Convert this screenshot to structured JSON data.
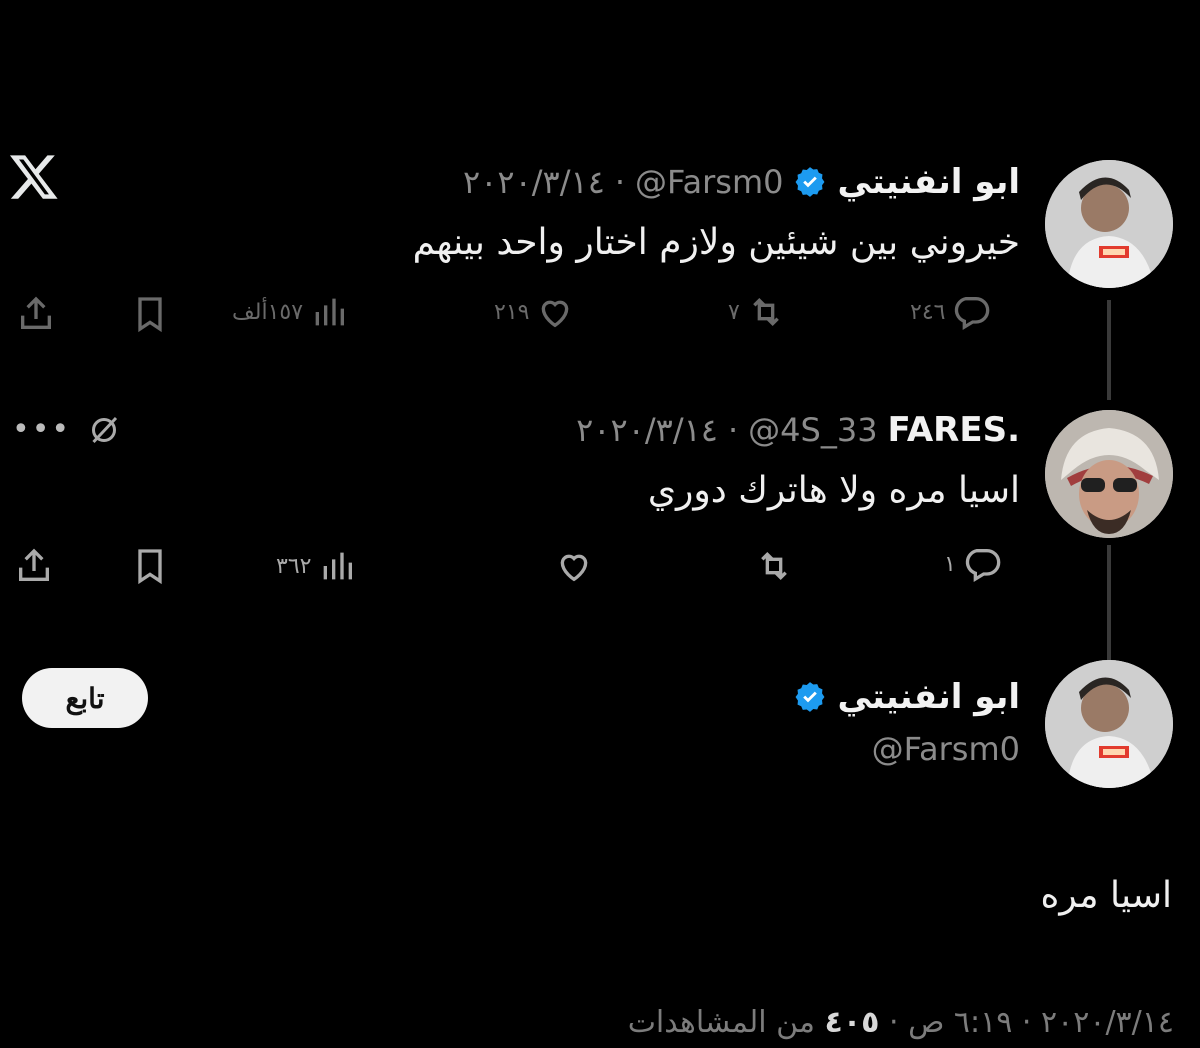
{
  "tweets": [
    {
      "name": "ابو انفنيتي",
      "handle": "@Farsm0",
      "date": "٢٠٢٠/٣/١٤",
      "text": "خيروني بين شيئين ولازم اختار واحد بينهم",
      "replies": "٢٤٦",
      "retweets": "٧",
      "likes": "٢١٩",
      "views": "١٥٧ألف"
    },
    {
      "name": "FARES.",
      "handle": "@4S_33",
      "date": "٢٠٢٠/٣/١٤",
      "text": "اسيا مره ولا هاترك دوري",
      "replies": "١",
      "views": "٣٦٢"
    }
  ],
  "main_tweet": {
    "name": "ابو انفنيتي",
    "handle": "@Farsm0",
    "follow_label": "تابع",
    "text": "اسيا مره",
    "timestamp": "٢٠٢٠/٣/١٤ · ٦:١٩ ص ·",
    "views_count": "٤٠٥",
    "views_label": "من المشاهدات"
  },
  "icons": {
    "x_logo": "x-logo-icon",
    "verified": "verified-badge-icon",
    "reply": "reply-icon",
    "retweet": "retweet-icon",
    "like": "like-icon",
    "views": "views-icon",
    "bookmark": "bookmark-icon",
    "share": "share-icon",
    "grok": "grok-icon",
    "more": "more-icon"
  },
  "colors": {
    "background": "#000000",
    "verified_blue": "#1d9bf0",
    "follow_button": "#f2f2f2"
  }
}
